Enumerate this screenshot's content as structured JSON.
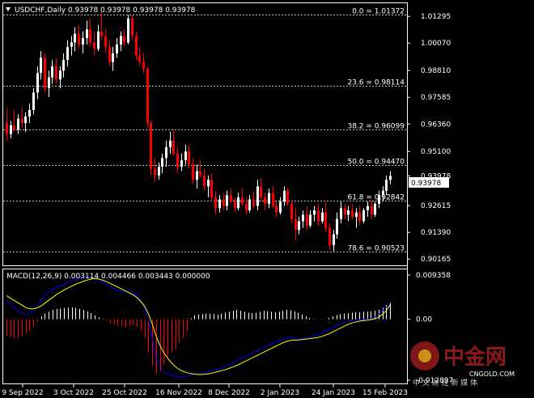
{
  "window": {
    "title": "USDCHF,Daily  0.93978 0.93978 0.93978 0.93978"
  },
  "colors": {
    "background": "#000000",
    "grid": "#ffffff",
    "bull": "#ffffff",
    "bear": "#ff0000",
    "macd_line": "#0000ff",
    "signal_line": "#ffff00",
    "hist_pos": "#ffffff",
    "hist_neg": "#ff0000",
    "current_price_bg": "#ffffff",
    "current_price_fg": "#000000",
    "watermark": "#8c1a1a"
  },
  "price_axis": {
    "ticks": [
      "1.01295",
      "1.00070",
      "0.98810",
      "0.97585",
      "0.96360",
      "0.95100",
      "0.93978",
      "0.92615",
      "0.91390",
      "0.90165"
    ],
    "current_price": "0.93978"
  },
  "fib_levels": [
    {
      "label": "0.0 = 1.01372"
    },
    {
      "label": "23.6 = 0.98114"
    },
    {
      "label": "38.2 = 0.96099"
    },
    {
      "label": "50.0 = 0.94470"
    },
    {
      "label": "61.8 = 0.92842"
    },
    {
      "label": "78.6 = 0.90523"
    }
  ],
  "macd": {
    "header": "MACD(12,26,9) 0.003114 0.004466 0.003443 0.000000",
    "axis_ticks": [
      "0.009358",
      "0.00",
      "-0.012897"
    ]
  },
  "time_axis": {
    "labels": [
      "9 Sep 2022",
      "3 Oct 2022",
      "25 Oct 2022",
      "16 Nov 2022",
      "8 Dec 2022",
      "2 Jan 2023",
      "24 Jan 2023",
      "15 Feb 2023"
    ]
  },
  "watermark": {
    "brand": "中金网",
    "site": "CNGOLD.COM",
    "slogan": "中 文 财 经 新 媒 体"
  },
  "chart_data": {
    "type": "candlestick",
    "symbol": "USDCHF",
    "timeframe": "Daily",
    "ylim": [
      0.901,
      1.016
    ],
    "candles": [
      {
        "o": 0.964,
        "h": 0.971,
        "l": 0.956,
        "c": 0.959
      },
      {
        "o": 0.959,
        "h": 0.965,
        "l": 0.957,
        "c": 0.963
      },
      {
        "o": 0.963,
        "h": 0.97,
        "l": 0.96,
        "c": 0.961
      },
      {
        "o": 0.961,
        "h": 0.968,
        "l": 0.959,
        "c": 0.966
      },
      {
        "o": 0.966,
        "h": 0.971,
        "l": 0.962,
        "c": 0.964
      },
      {
        "o": 0.964,
        "h": 0.969,
        "l": 0.96,
        "c": 0.967
      },
      {
        "o": 0.967,
        "h": 0.973,
        "l": 0.964,
        "c": 0.97
      },
      {
        "o": 0.97,
        "h": 0.98,
        "l": 0.968,
        "c": 0.978
      },
      {
        "o": 0.978,
        "h": 0.99,
        "l": 0.975,
        "c": 0.987
      },
      {
        "o": 0.987,
        "h": 0.997,
        "l": 0.984,
        "c": 0.994
      },
      {
        "o": 0.994,
        "h": 0.996,
        "l": 0.978,
        "c": 0.98
      },
      {
        "o": 0.98,
        "h": 0.988,
        "l": 0.976,
        "c": 0.985
      },
      {
        "o": 0.985,
        "h": 0.993,
        "l": 0.982,
        "c": 0.99
      },
      {
        "o": 0.99,
        "h": 0.994,
        "l": 0.982,
        "c": 0.984
      },
      {
        "o": 0.984,
        "h": 0.99,
        "l": 0.98,
        "c": 0.988
      },
      {
        "o": 0.988,
        "h": 0.996,
        "l": 0.985,
        "c": 0.993
      },
      {
        "o": 0.993,
        "h": 1.002,
        "l": 0.99,
        "c": 0.999
      },
      {
        "o": 0.999,
        "h": 1.004,
        "l": 0.995,
        "c": 1.001
      },
      {
        "o": 1.001,
        "h": 1.008,
        "l": 0.997,
        "c": 1.005
      },
      {
        "o": 1.005,
        "h": 1.009,
        "l": 0.998,
        "c": 1.0
      },
      {
        "o": 1.0,
        "h": 1.006,
        "l": 0.996,
        "c": 1.003
      },
      {
        "o": 1.003,
        "h": 1.011,
        "l": 1.0,
        "c": 1.007
      },
      {
        "o": 1.007,
        "h": 1.012,
        "l": 0.999,
        "c": 1.001
      },
      {
        "o": 1.001,
        "h": 1.006,
        "l": 0.995,
        "c": 0.998
      },
      {
        "o": 0.998,
        "h": 1.009,
        "l": 0.997,
        "c": 1.006
      },
      {
        "o": 1.006,
        "h": 1.0148,
        "l": 1.002,
        "c": 1.004
      },
      {
        "o": 1.004,
        "h": 1.007,
        "l": 0.996,
        "c": 0.999
      },
      {
        "o": 0.999,
        "h": 1.002,
        "l": 0.99,
        "c": 0.992
      },
      {
        "o": 0.992,
        "h": 0.999,
        "l": 0.988,
        "c": 0.996
      },
      {
        "o": 0.996,
        "h": 1.003,
        "l": 0.994,
        "c": 1.0
      },
      {
        "o": 1.0,
        "h": 1.006,
        "l": 0.997,
        "c": 1.004
      },
      {
        "o": 1.004,
        "h": 1.007,
        "l": 0.999,
        "c": 1.001
      },
      {
        "o": 1.001,
        "h": 1.0137,
        "l": 1.0,
        "c": 1.012
      },
      {
        "o": 1.012,
        "h": 1.0135,
        "l": 1.002,
        "c": 1.004
      },
      {
        "o": 1.004,
        "h": 1.006,
        "l": 0.993,
        "c": 0.995
      },
      {
        "o": 0.995,
        "h": 0.999,
        "l": 0.99,
        "c": 0.992
      },
      {
        "o": 0.992,
        "h": 0.996,
        "l": 0.987,
        "c": 0.989
      },
      {
        "o": 0.989,
        "h": 0.99,
        "l": 0.962,
        "c": 0.964
      },
      {
        "o": 0.964,
        "h": 0.965,
        "l": 0.94,
        "c": 0.943
      },
      {
        "o": 0.943,
        "h": 0.948,
        "l": 0.937,
        "c": 0.94
      },
      {
        "o": 0.94,
        "h": 0.946,
        "l": 0.938,
        "c": 0.944
      },
      {
        "o": 0.944,
        "h": 0.95,
        "l": 0.941,
        "c": 0.948
      },
      {
        "o": 0.948,
        "h": 0.956,
        "l": 0.944,
        "c": 0.953
      },
      {
        "o": 0.953,
        "h": 0.96,
        "l": 0.95,
        "c": 0.956
      },
      {
        "o": 0.956,
        "h": 0.961,
        "l": 0.949,
        "c": 0.95
      },
      {
        "o": 0.95,
        "h": 0.953,
        "l": 0.941,
        "c": 0.944
      },
      {
        "o": 0.944,
        "h": 0.95,
        "l": 0.942,
        "c": 0.947
      },
      {
        "o": 0.947,
        "h": 0.954,
        "l": 0.945,
        "c": 0.951
      },
      {
        "o": 0.951,
        "h": 0.954,
        "l": 0.943,
        "c": 0.945
      },
      {
        "o": 0.945,
        "h": 0.948,
        "l": 0.936,
        "c": 0.938
      },
      {
        "o": 0.938,
        "h": 0.945,
        "l": 0.934,
        "c": 0.942
      },
      {
        "o": 0.942,
        "h": 0.947,
        "l": 0.939,
        "c": 0.94
      },
      {
        "o": 0.94,
        "h": 0.943,
        "l": 0.933,
        "c": 0.935
      },
      {
        "o": 0.935,
        "h": 0.94,
        "l": 0.93,
        "c": 0.938
      },
      {
        "o": 0.938,
        "h": 0.941,
        "l": 0.928,
        "c": 0.93
      },
      {
        "o": 0.93,
        "h": 0.933,
        "l": 0.922,
        "c": 0.925
      },
      {
        "o": 0.925,
        "h": 0.931,
        "l": 0.923,
        "c": 0.929
      },
      {
        "o": 0.929,
        "h": 0.932,
        "l": 0.924,
        "c": 0.926
      },
      {
        "o": 0.926,
        "h": 0.933,
        "l": 0.924,
        "c": 0.931
      },
      {
        "o": 0.931,
        "h": 0.934,
        "l": 0.927,
        "c": 0.928
      },
      {
        "o": 0.928,
        "h": 0.93,
        "l": 0.923,
        "c": 0.925
      },
      {
        "o": 0.925,
        "h": 0.932,
        "l": 0.924,
        "c": 0.93
      },
      {
        "o": 0.93,
        "h": 0.934,
        "l": 0.926,
        "c": 0.927
      },
      {
        "o": 0.927,
        "h": 0.93,
        "l": 0.922,
        "c": 0.924
      },
      {
        "o": 0.924,
        "h": 0.931,
        "l": 0.923,
        "c": 0.929
      },
      {
        "o": 0.929,
        "h": 0.933,
        "l": 0.925,
        "c": 0.926
      },
      {
        "o": 0.926,
        "h": 0.938,
        "l": 0.924,
        "c": 0.935
      },
      {
        "o": 0.935,
        "h": 0.939,
        "l": 0.928,
        "c": 0.93
      },
      {
        "o": 0.93,
        "h": 0.932,
        "l": 0.924,
        "c": 0.927
      },
      {
        "o": 0.927,
        "h": 0.934,
        "l": 0.925,
        "c": 0.932
      },
      {
        "o": 0.932,
        "h": 0.935,
        "l": 0.925,
        "c": 0.926
      },
      {
        "o": 0.926,
        "h": 0.928,
        "l": 0.921,
        "c": 0.923
      },
      {
        "o": 0.923,
        "h": 0.93,
        "l": 0.922,
        "c": 0.928
      },
      {
        "o": 0.928,
        "h": 0.935,
        "l": 0.926,
        "c": 0.933
      },
      {
        "o": 0.933,
        "h": 0.934,
        "l": 0.926,
        "c": 0.927
      },
      {
        "o": 0.927,
        "h": 0.929,
        "l": 0.918,
        "c": 0.92
      },
      {
        "o": 0.92,
        "h": 0.925,
        "l": 0.91,
        "c": 0.915
      },
      {
        "o": 0.915,
        "h": 0.921,
        "l": 0.913,
        "c": 0.919
      },
      {
        "o": 0.919,
        "h": 0.924,
        "l": 0.916,
        "c": 0.922
      },
      {
        "o": 0.922,
        "h": 0.926,
        "l": 0.915,
        "c": 0.917
      },
      {
        "o": 0.917,
        "h": 0.924,
        "l": 0.916,
        "c": 0.922
      },
      {
        "o": 0.922,
        "h": 0.926,
        "l": 0.919,
        "c": 0.924
      },
      {
        "o": 0.924,
        "h": 0.927,
        "l": 0.917,
        "c": 0.919
      },
      {
        "o": 0.919,
        "h": 0.925,
        "l": 0.918,
        "c": 0.923
      },
      {
        "o": 0.923,
        "h": 0.928,
        "l": 0.914,
        "c": 0.916
      },
      {
        "o": 0.916,
        "h": 0.918,
        "l": 0.906,
        "c": 0.908
      },
      {
        "o": 0.908,
        "h": 0.915,
        "l": 0.9052,
        "c": 0.913
      },
      {
        "o": 0.913,
        "h": 0.923,
        "l": 0.911,
        "c": 0.92
      },
      {
        "o": 0.92,
        "h": 0.928,
        "l": 0.918,
        "c": 0.925
      },
      {
        "o": 0.925,
        "h": 0.927,
        "l": 0.92,
        "c": 0.922
      },
      {
        "o": 0.922,
        "h": 0.926,
        "l": 0.919,
        "c": 0.924
      },
      {
        "o": 0.924,
        "h": 0.927,
        "l": 0.92,
        "c": 0.921
      },
      {
        "o": 0.921,
        "h": 0.925,
        "l": 0.916,
        "c": 0.923
      },
      {
        "o": 0.923,
        "h": 0.926,
        "l": 0.917,
        "c": 0.919
      },
      {
        "o": 0.919,
        "h": 0.925,
        "l": 0.918,
        "c": 0.924
      },
      {
        "o": 0.924,
        "h": 0.928,
        "l": 0.921,
        "c": 0.926
      },
      {
        "o": 0.926,
        "h": 0.929,
        "l": 0.92,
        "c": 0.922
      },
      {
        "o": 0.922,
        "h": 0.928,
        "l": 0.921,
        "c": 0.927
      },
      {
        "o": 0.927,
        "h": 0.933,
        "l": 0.925,
        "c": 0.931
      },
      {
        "o": 0.931,
        "h": 0.935,
        "l": 0.928,
        "c": 0.933
      },
      {
        "o": 0.933,
        "h": 0.94,
        "l": 0.931,
        "c": 0.938
      },
      {
        "o": 0.938,
        "h": 0.942,
        "l": 0.936,
        "c": 0.9398
      }
    ],
    "macd": {
      "ylim": [
        -0.012897,
        0.009358
      ],
      "histogram": [
        -0.0035,
        -0.0038,
        -0.004,
        -0.0039,
        -0.0035,
        -0.003,
        -0.0024,
        -0.0015,
        -0.0005,
        0.0006,
        0.0012,
        0.0016,
        0.002,
        0.0022,
        0.0023,
        0.0024,
        0.0025,
        0.0025,
        0.0024,
        0.0022,
        0.002,
        0.0017,
        0.0013,
        0.0008,
        0.0004,
        0.0001,
        -0.0003,
        -0.0008,
        -0.0012,
        -0.0014,
        -0.0015,
        -0.0016,
        -0.0014,
        -0.0012,
        -0.0016,
        -0.0025,
        -0.004,
        -0.007,
        -0.01,
        -0.0115,
        -0.011,
        -0.0095,
        -0.008,
        -0.007,
        -0.0062,
        -0.005,
        -0.004,
        -0.0025,
        0.0002,
        0.0008,
        0.001,
        0.0011,
        0.0012,
        0.0012,
        0.0011,
        0.001,
        0.0012,
        0.0014,
        0.0016,
        0.0018,
        0.002,
        0.0018,
        0.0016,
        0.0014,
        0.0013,
        0.0014,
        0.0016,
        0.0018,
        0.0017,
        0.0016,
        0.0015,
        0.0016,
        0.0018,
        0.002,
        0.0019,
        0.0017,
        0.0014,
        0.001,
        0.0006,
        0.0003,
        0.0001,
        -0.0001,
        -0.0002,
        0.0,
        0.0003,
        0.0006,
        0.0009,
        0.0011,
        0.0012,
        0.0013,
        0.0014,
        0.0015,
        0.0015,
        0.0016,
        0.0016,
        0.0017,
        0.0018,
        0.002,
        0.0024,
        0.003,
        0.0034
      ],
      "macd_line": [
        0.004,
        0.0032,
        0.0025,
        0.0018,
        0.0012,
        0.001,
        0.0012,
        0.0018,
        0.0028,
        0.004,
        0.0052,
        0.0058,
        0.0064,
        0.0068,
        0.007,
        0.0074,
        0.0078,
        0.0082,
        0.0086,
        0.0088,
        0.009,
        0.009,
        0.0088,
        0.0085,
        0.0082,
        0.008,
        0.0076,
        0.007,
        0.0065,
        0.0062,
        0.006,
        0.0058,
        0.006,
        0.0058,
        0.005,
        0.004,
        0.0025,
        0.0,
        -0.004,
        -0.008,
        -0.0105,
        -0.0112,
        -0.0115,
        -0.0118,
        -0.012,
        -0.0122,
        -0.0122,
        -0.012,
        -0.0118,
        -0.0117,
        -0.0116,
        -0.0115,
        -0.0112,
        -0.011,
        -0.0108,
        -0.0106,
        -0.0104,
        -0.01,
        -0.0096,
        -0.0092,
        -0.0088,
        -0.0084,
        -0.008,
        -0.0076,
        -0.0072,
        -0.0068,
        -0.0064,
        -0.006,
        -0.0056,
        -0.0052,
        -0.0048,
        -0.0045,
        -0.0042,
        -0.004,
        -0.0038,
        -0.004,
        -0.004,
        -0.0042,
        -0.004,
        -0.0038,
        -0.0036,
        -0.0034,
        -0.003,
        -0.0026,
        -0.0022,
        -0.0018,
        -0.0014,
        -0.001,
        -0.0006,
        -0.0004,
        -0.0003,
        -0.0002,
        -0.0002,
        -0.0001,
        0.0,
        0.0002,
        0.0005,
        0.001,
        0.0018,
        0.0026,
        0.0031
      ],
      "signal_line": [
        0.005,
        0.0045,
        0.004,
        0.0035,
        0.003,
        0.0025,
        0.0022,
        0.0022,
        0.0024,
        0.0028,
        0.0034,
        0.004,
        0.0046,
        0.0052,
        0.0057,
        0.0062,
        0.0066,
        0.007,
        0.0074,
        0.0077,
        0.008,
        0.0083,
        0.0085,
        0.0086,
        0.0085,
        0.0083,
        0.008,
        0.0076,
        0.0072,
        0.0068,
        0.0064,
        0.006,
        0.0056,
        0.0052,
        0.0046,
        0.0038,
        0.0028,
        0.0012,
        -0.001,
        -0.0035,
        -0.0055,
        -0.007,
        -0.0082,
        -0.0092,
        -0.01,
        -0.0106,
        -0.011,
        -0.0113,
        -0.0115,
        -0.0116,
        -0.0117,
        -0.0117,
        -0.0116,
        -0.0115,
        -0.0113,
        -0.0111,
        -0.0109,
        -0.0107,
        -0.0104,
        -0.0101,
        -0.0098,
        -0.0094,
        -0.009,
        -0.0086,
        -0.0082,
        -0.0078,
        -0.0074,
        -0.007,
        -0.0066,
        -0.0062,
        -0.0058,
        -0.0054,
        -0.005,
        -0.0047,
        -0.0045,
        -0.0044,
        -0.0044,
        -0.0043,
        -0.0042,
        -0.0041,
        -0.004,
        -0.0039,
        -0.0037,
        -0.0034,
        -0.0031,
        -0.0027,
        -0.0023,
        -0.0019,
        -0.0015,
        -0.0011,
        -0.0008,
        -0.0006,
        -0.0004,
        -0.0003,
        -0.0002,
        -0.0001,
        0.0001,
        0.0004,
        0.001,
        0.0018,
        0.003
      ]
    }
  }
}
